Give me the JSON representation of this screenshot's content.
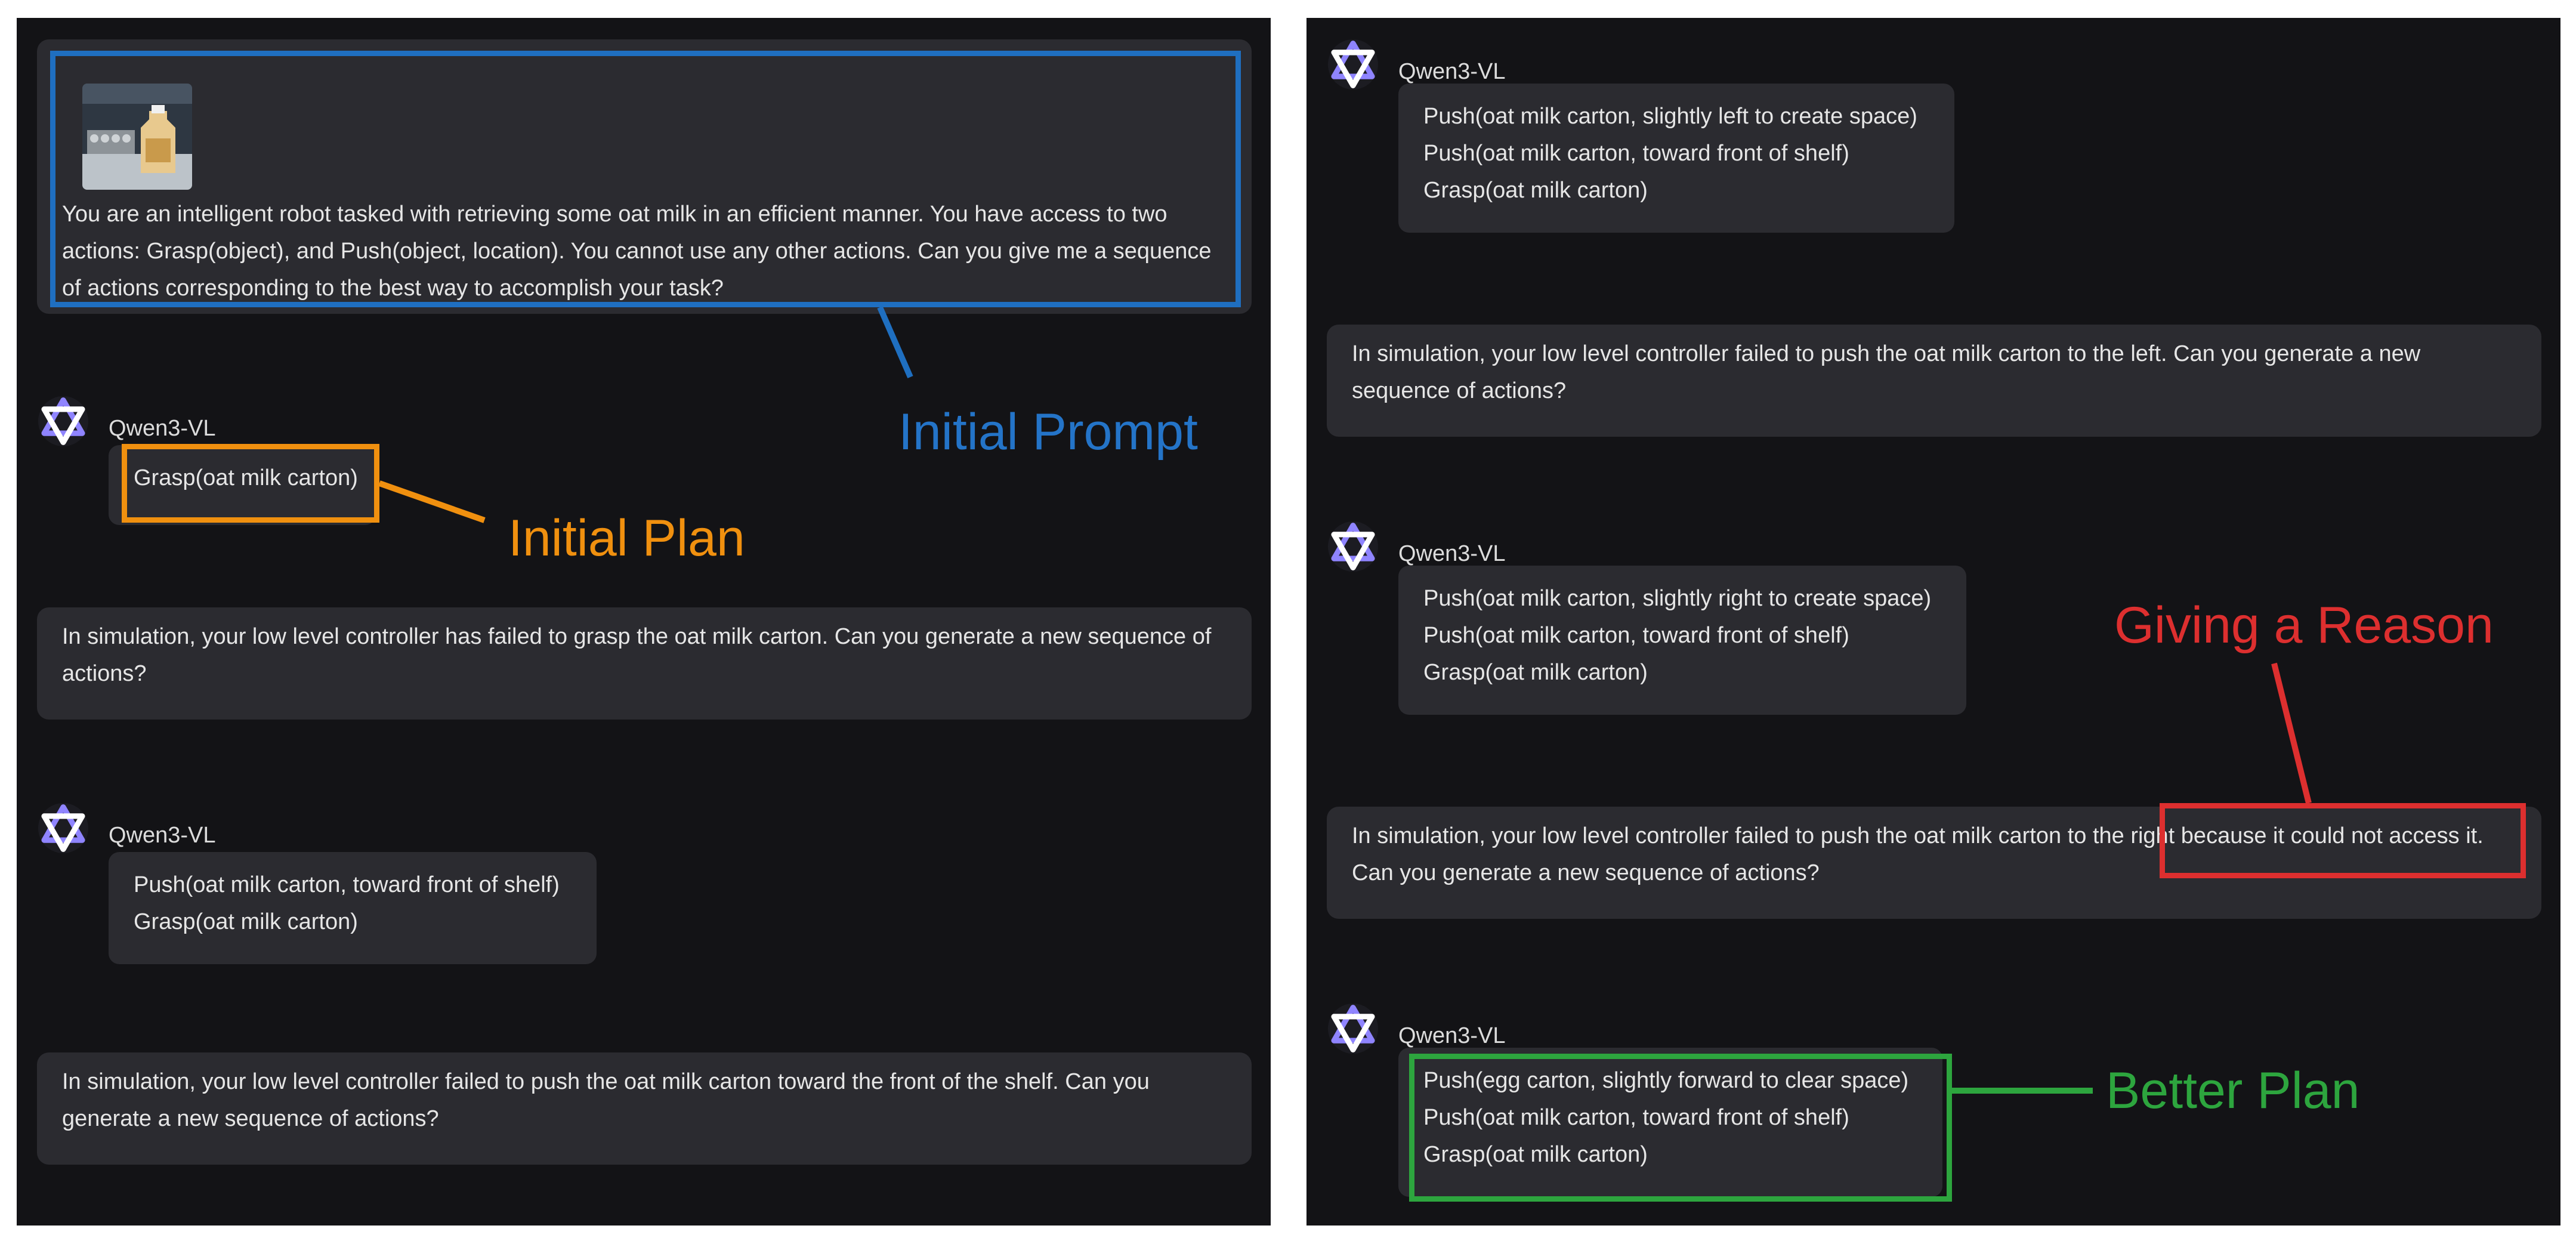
{
  "assistant_name": "Qwen3-VL",
  "left_panel": {
    "initial_prompt": "You are an intelligent robot tasked with retrieving some oat milk in an efficient manner. You have access to two actions: Grasp(object), and Push(object, location). You cannot use any other actions. Can you give me a sequence of actions corresponding to the best way to accomplish your task?",
    "reply_1": [
      "Grasp(oat milk carton)"
    ],
    "user_2": "In simulation, your low level controller has failed to grasp the oat milk carton. Can you generate a new sequence of actions?",
    "reply_2": [
      "Push(oat milk carton, toward front of shelf)",
      "Grasp(oat milk carton)"
    ],
    "user_3": "In simulation, your low level controller failed to push the oat milk carton toward the front of the shelf. Can you generate a new sequence of actions?"
  },
  "right_panel": {
    "reply_3": [
      "Push(oat milk carton, slightly left to create space)",
      "Push(oat milk carton, toward front of shelf)",
      "Grasp(oat milk carton)"
    ],
    "user_4": "In simulation, your low level controller failed to push the oat milk carton to the left. Can you generate a new sequence of actions?",
    "reply_4": [
      "Push(oat milk carton, slightly right to create space)",
      "Push(oat milk carton, toward front of shelf)",
      "Grasp(oat milk carton)"
    ],
    "user_5": "In simulation, your low level controller failed to push the oat milk carton to the right because it could not access it. Can you generate a new sequence of actions?",
    "reply_5": [
      "Push(egg carton, slightly forward to clear space)",
      "Push(oat milk carton, toward front of shelf)",
      "Grasp(oat milk carton)"
    ]
  },
  "annotations": {
    "initial_prompt": "Initial Prompt",
    "initial_plan": "Initial Plan",
    "giving_reason": "Giving a Reason",
    "better_plan": "Better Plan"
  },
  "annotation_colors": {
    "blue": "#1f6fc0",
    "orange": "#f0900f",
    "red": "#dd2f2f",
    "green": "#2da53e"
  },
  "icons": {
    "assistant_logo": "qwen-logo-icon",
    "prompt_image": "refrigerator-shelf-photo"
  }
}
